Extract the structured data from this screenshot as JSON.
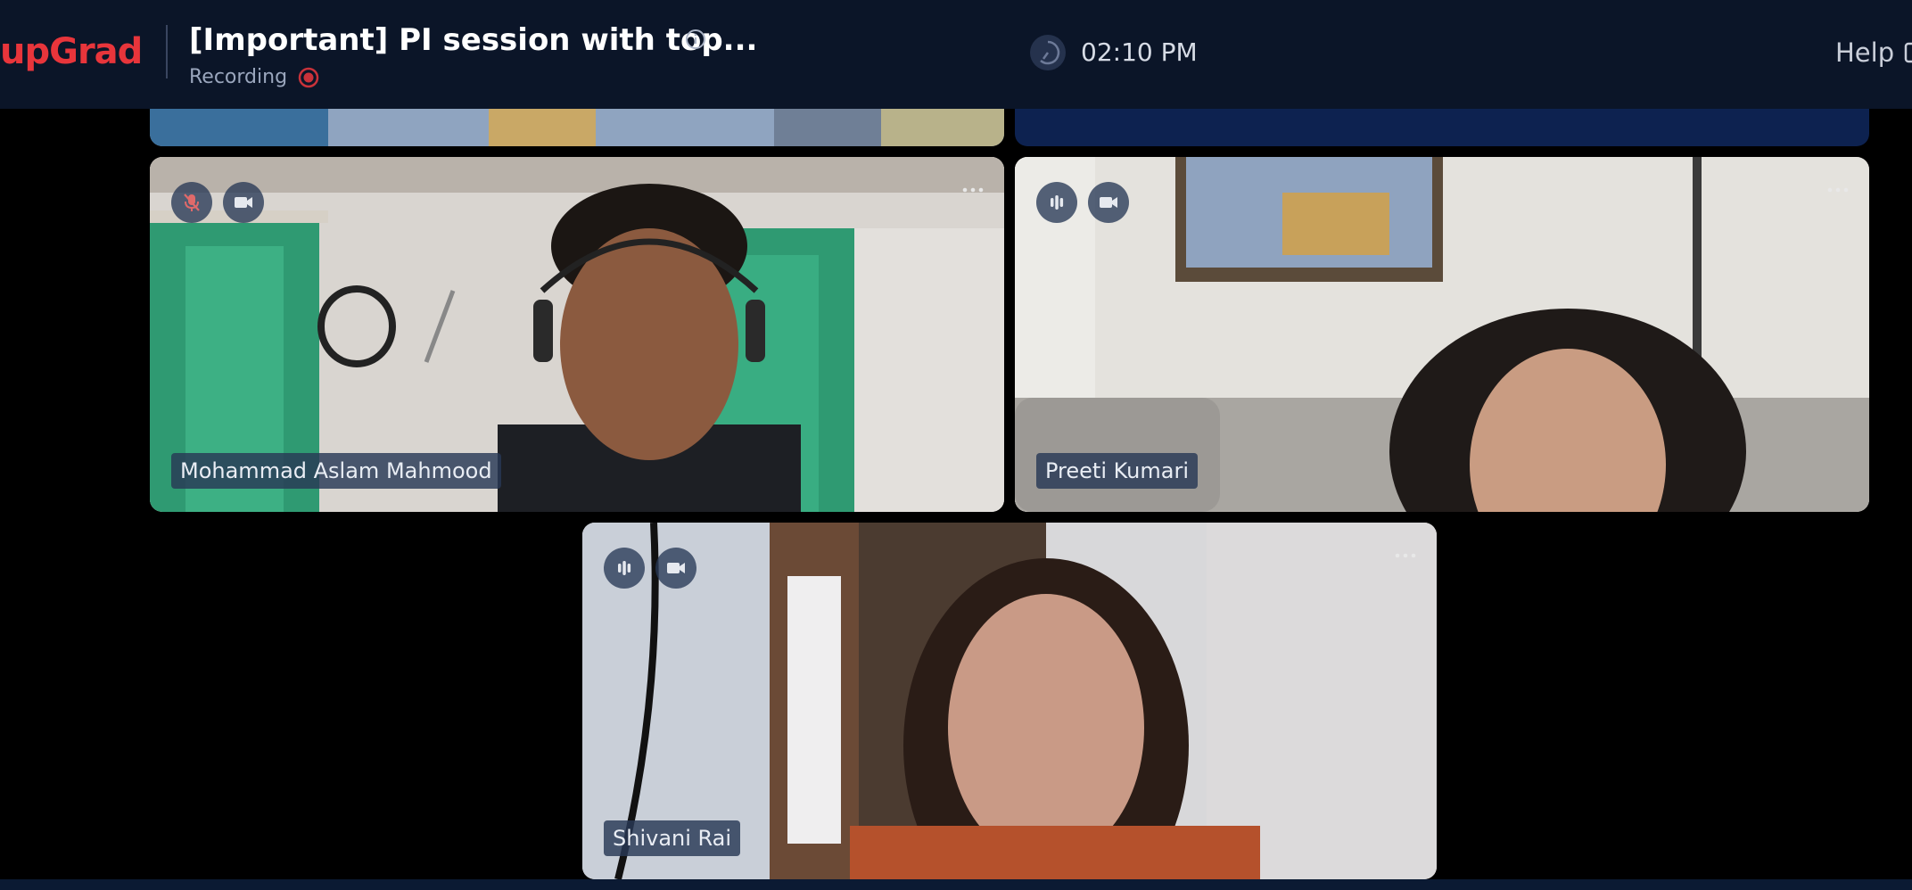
{
  "header": {
    "logo": "upGrad",
    "title": "[Important] PI session with top...",
    "recording_label": "Recording",
    "time": "02:10 PM",
    "help_label": "Help"
  },
  "colors": {
    "header_bg": "#0b1528",
    "brand_red": "#e8353b",
    "label_bg": "#283856"
  },
  "participants": [
    {
      "name": "Mohammad Aslam Mahmood",
      "mic": "muted",
      "camera": "on"
    },
    {
      "name": "Preeti Kumari",
      "mic": "speaking",
      "camera": "on"
    },
    {
      "name": "Shivani Rai",
      "mic": "speaking",
      "camera": "on"
    }
  ],
  "icons": {
    "info": "info-icon",
    "recording": "record-icon",
    "clock": "clock-icon",
    "mic_muted": "mic-off-icon",
    "audio_level": "audio-level-icon",
    "camera": "video-camera-icon",
    "more": "more-options-icon"
  }
}
